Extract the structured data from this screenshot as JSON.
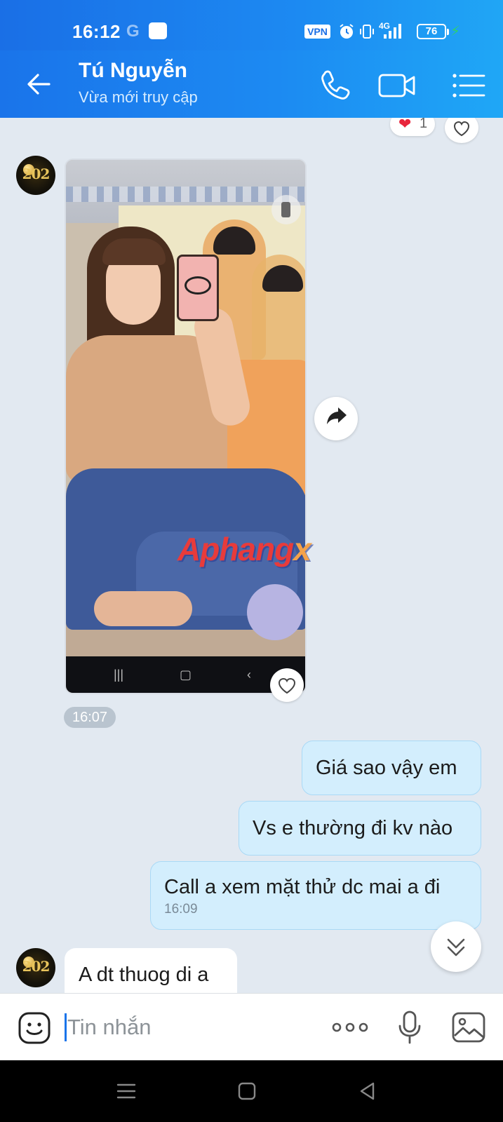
{
  "status_bar": {
    "time": "16:12",
    "google_icon": "G",
    "vpn_label": "VPN",
    "network_label": "4G",
    "battery_level": "76",
    "icons": [
      "alarm-icon",
      "vibrate-icon",
      "signal-icon",
      "battery-icon",
      "charging-icon"
    ]
  },
  "header": {
    "contact_name": "Tú Nguyễn",
    "contact_status": "Vừa mới truy cập",
    "icons": [
      "back-arrow-icon",
      "phone-icon",
      "video-call-icon",
      "menu-list-icon"
    ]
  },
  "chat": {
    "top_reaction": {
      "emoji": "❤",
      "count": "1"
    },
    "photo_message": {
      "watermark_main": "Aphang",
      "watermark_x": "x",
      "time": "16:07"
    },
    "outgoing": [
      {
        "text": "Giá sao vậy em"
      },
      {
        "text": "Vs e thường đi kv nào"
      },
      {
        "text": "Call a xem mặt thử dc mai a đi",
        "time": "16:09"
      }
    ],
    "incoming_last": {
      "text": "A dt thuog di a"
    }
  },
  "composer": {
    "placeholder": "Tin nhắn",
    "icons": [
      "emoji-icon",
      "more-dots-icon",
      "microphone-icon",
      "gallery-icon"
    ]
  },
  "colors": {
    "header_blue": "#1c8af2",
    "outgoing_bubble": "#d3eefd",
    "chat_background": "#e2e9f1",
    "heart_red": "#e8263c"
  }
}
